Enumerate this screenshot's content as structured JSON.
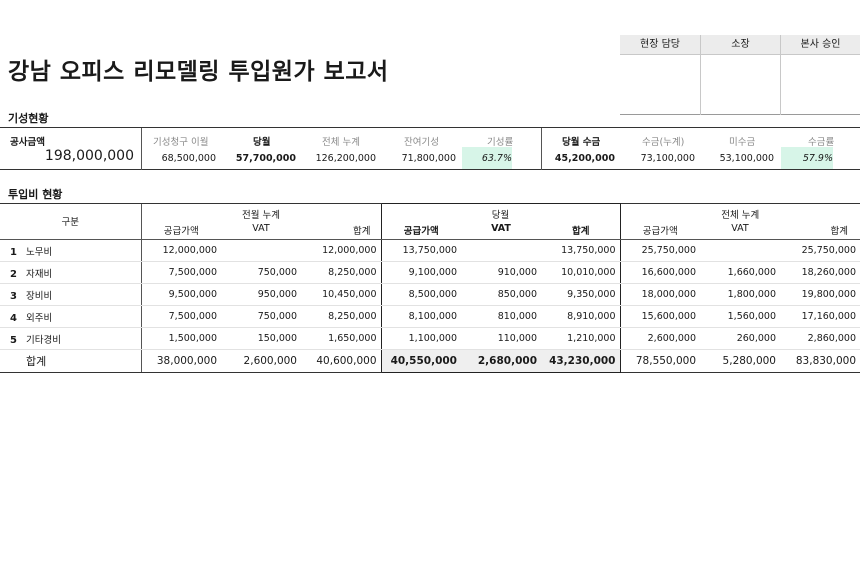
{
  "title": "강남 오피스 리모델링 투입원가 보고서",
  "approval": [
    "현장 담당",
    "소장",
    "본사 승인"
  ],
  "progress_section": "기성현황",
  "progress": {
    "contract_label": "공사금액",
    "contract_value": "198,000,000",
    "claimed_prev_label": "기성청구 이월",
    "claimed_prev_value": "68,500,000",
    "current_label": "당월",
    "current_value": "57,700,000",
    "total_cum_label": "전체 누계",
    "total_cum_value": "126,200,000",
    "remaining_label": "잔여기성",
    "remaining_value": "71,800,000",
    "rate_label": "기성률",
    "rate_value": "63.7%",
    "rate_fraction": 0.637,
    "month_collect_label": "당월 수금",
    "month_collect_value": "45,200,000",
    "collect_cum_label": "수금(누계)",
    "collect_cum_value": "73,100,000",
    "uncollected_label": "미수금",
    "uncollected_value": "53,100,000",
    "collect_rate_label": "수금률",
    "collect_rate_value": "57.9%",
    "collect_rate_fraction": 0.579,
    "rate_color": "#d7f5e8"
  },
  "cost_section": "투입비 현황",
  "cost_table": {
    "category_header": "구분",
    "groups": [
      "전월 누계",
      "당월",
      "전체 누계"
    ],
    "subheaders": [
      "공급가액",
      "VAT",
      "합계"
    ],
    "rows": [
      {
        "no": "1",
        "name": "노무비",
        "prev": [
          "12,000,000",
          "",
          "12,000,000"
        ],
        "cur": [
          "13,750,000",
          "",
          "13,750,000"
        ],
        "all": [
          "25,750,000",
          "",
          "25,750,000"
        ]
      },
      {
        "no": "2",
        "name": "자재비",
        "prev": [
          "7,500,000",
          "750,000",
          "8,250,000"
        ],
        "cur": [
          "9,100,000",
          "910,000",
          "10,010,000"
        ],
        "all": [
          "16,600,000",
          "1,660,000",
          "18,260,000"
        ]
      },
      {
        "no": "3",
        "name": "장비비",
        "prev": [
          "9,500,000",
          "950,000",
          "10,450,000"
        ],
        "cur": [
          "8,500,000",
          "850,000",
          "9,350,000"
        ],
        "all": [
          "18,000,000",
          "1,800,000",
          "19,800,000"
        ]
      },
      {
        "no": "4",
        "name": "외주비",
        "prev": [
          "7,500,000",
          "750,000",
          "8,250,000"
        ],
        "cur": [
          "8,100,000",
          "810,000",
          "8,910,000"
        ],
        "all": [
          "15,600,000",
          "1,560,000",
          "17,160,000"
        ]
      },
      {
        "no": "5",
        "name": "기타경비",
        "prev": [
          "1,500,000",
          "150,000",
          "1,650,000"
        ],
        "cur": [
          "1,100,000",
          "110,000",
          "1,210,000"
        ],
        "all": [
          "2,600,000",
          "260,000",
          "2,860,000"
        ]
      }
    ],
    "total": {
      "name": "합계",
      "prev": [
        "38,000,000",
        "2,600,000",
        "40,600,000"
      ],
      "cur": [
        "40,550,000",
        "2,680,000",
        "43,230,000"
      ],
      "all": [
        "78,550,000",
        "5,280,000",
        "83,830,000"
      ]
    }
  }
}
